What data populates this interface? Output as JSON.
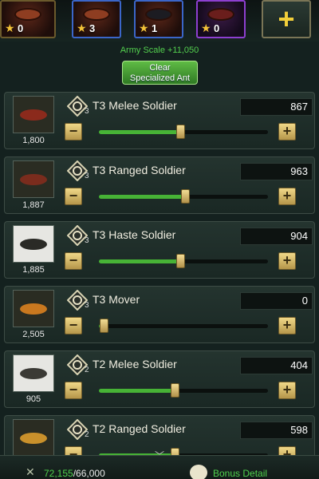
{
  "hero_slots": [
    {
      "star_count": "0",
      "border_color": "#6b5a2c"
    },
    {
      "star_count": "3",
      "border_color": "#3b66c9"
    },
    {
      "star_count": "1",
      "border_color": "#3b66c9"
    },
    {
      "star_count": "0",
      "border_color": "#8d3fd0"
    }
  ],
  "add_slot_label": "+",
  "army_scale": "Army Scale +11,050",
  "clear_button": {
    "line1": "Clear",
    "line2": "Specialized Ant"
  },
  "units": [
    {
      "name": "T3 Melee Soldier",
      "tier": "3",
      "count": "1,800",
      "quantity": "867",
      "slider_fraction": 0.48,
      "body_color": "#8b2a1c"
    },
    {
      "name": "T3 Ranged Soldier",
      "tier": "3",
      "count": "1,887",
      "quantity": "963",
      "slider_fraction": 0.51,
      "body_color": "#7a2c1d"
    },
    {
      "name": "T3 Haste Soldier",
      "tier": "3",
      "count": "1,885",
      "quantity": "904",
      "slider_fraction": 0.48,
      "body_color": "#2a2a26"
    },
    {
      "name": "T3 Mover",
      "tier": "3",
      "count": "2,505",
      "quantity": "0",
      "slider_fraction": 0.03,
      "body_color": "#c9781f"
    },
    {
      "name": "T2 Melee Soldier",
      "tier": "2",
      "count": "905",
      "quantity": "404",
      "slider_fraction": 0.45,
      "body_color": "#3b3a35"
    },
    {
      "name": "T2 Ranged Soldier",
      "tier": "2",
      "count": "",
      "quantity": "598",
      "slider_fraction": 0.45,
      "body_color": "#c9902b"
    }
  ],
  "capacity": {
    "current": "72,155",
    "max": "/66,000"
  },
  "bonus_detail_label": "Bonus Detail",
  "colors": {
    "accent_green": "#4fd14c",
    "button_gold": "#f0d888",
    "panel_bg": "#14211f"
  }
}
